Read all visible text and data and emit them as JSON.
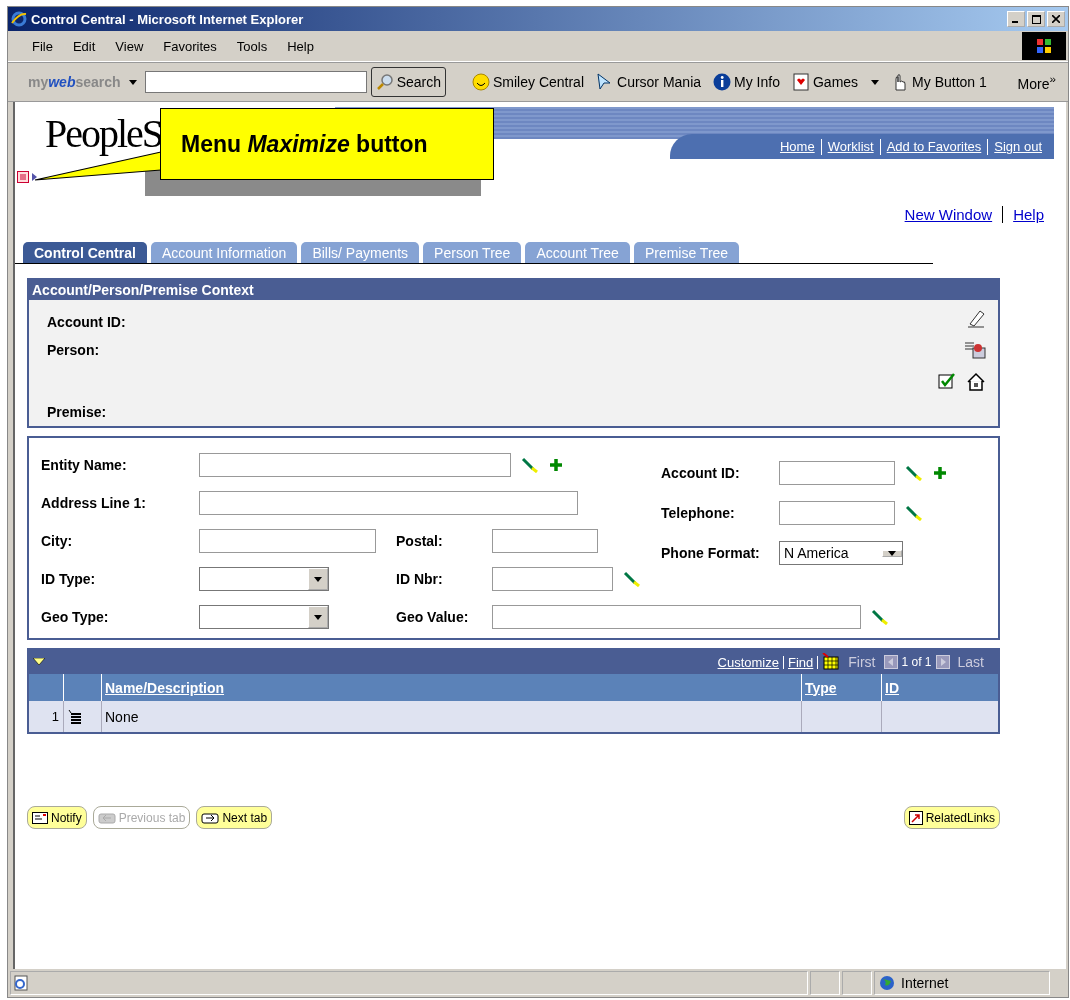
{
  "window": {
    "title": "Control Central - Microsoft Internet Explorer"
  },
  "menu": [
    "File",
    "Edit",
    "View",
    "Favorites",
    "Tools",
    "Help"
  ],
  "toolbar": {
    "brand": "my**web**search",
    "items": [
      {
        "kind": "search",
        "label": "Search"
      },
      {
        "kind": "smiley",
        "label": "Smiley Central"
      },
      {
        "kind": "cursor",
        "label": "Cursor Mania"
      },
      {
        "kind": "info",
        "label": "My Info"
      },
      {
        "kind": "games",
        "label": "Games"
      },
      {
        "kind": "hand",
        "label": "My Button 1"
      }
    ],
    "more": "More",
    "more_icon": "»"
  },
  "header": {
    "logo": "PeopleS",
    "links": [
      "Home",
      "Worklist",
      "Add to Favorites",
      "Sign out"
    ]
  },
  "callout": "Menu *Maximize* button",
  "top_links": [
    "New Window",
    "Help"
  ],
  "tabs": [
    {
      "label": "Control Central",
      "selected": true
    },
    {
      "label": "Account Information",
      "selected": false
    },
    {
      "label": "Bills/ Payments",
      "selected": false
    },
    {
      "label": "Person Tree",
      "selected": false
    },
    {
      "label": "Account Tree",
      "selected": false
    },
    {
      "label": "Premise Tree",
      "selected": false
    }
  ],
  "context": {
    "title": "Account/Person/Premise Context",
    "labels": [
      "Account ID:",
      "Person:",
      "Premise:"
    ]
  },
  "search": {
    "left": [
      {
        "label": "Entity Name:",
        "kind": "input",
        "lookup": true,
        "add": true
      },
      {
        "label": "Address Line 1:",
        "kind": "input",
        "lookup": false,
        "add": false
      },
      {
        "label": "City:",
        "kind": "input",
        "lookup": false,
        "add": false,
        "second": {
          "label": "Postal:",
          "kind": "input",
          "lookup": false
        }
      },
      {
        "label": "ID Type:",
        "kind": "select",
        "lookup": false,
        "add": false,
        "second": {
          "label": "ID Nbr:",
          "kind": "input",
          "lookup": true
        }
      },
      {
        "label": "Geo Type:",
        "kind": "select",
        "lookup": false,
        "add": false,
        "second": {
          "label": "Geo Value:",
          "kind": "input",
          "lookup": true
        }
      }
    ],
    "right": [
      {
        "label": "Account ID:",
        "kind": "input",
        "lookup": true,
        "add": true
      },
      {
        "label": "Telephone:",
        "kind": "input",
        "lookup": true,
        "add": false
      },
      {
        "label": "Phone Format:",
        "kind": "select",
        "value": "N America",
        "lookup": false,
        "add": false
      }
    ]
  },
  "grid": {
    "links": [
      "Customize",
      "Find"
    ],
    "first": "First",
    "count": "1 of 1",
    "last": "Last",
    "columns": [
      "Name/Description",
      "Type",
      "ID"
    ],
    "rows": [
      {
        "num": "1",
        "name": "None"
      }
    ]
  },
  "buttons": [
    {
      "kind": "notify",
      "label": "Notify",
      "disabled": false
    },
    {
      "kind": "prev",
      "label": "Previous tab",
      "disabled": true
    },
    {
      "kind": "next",
      "label": "Next tab",
      "disabled": false
    }
  ],
  "related": "RelatedLinks",
  "status": {
    "zone": "Internet"
  }
}
